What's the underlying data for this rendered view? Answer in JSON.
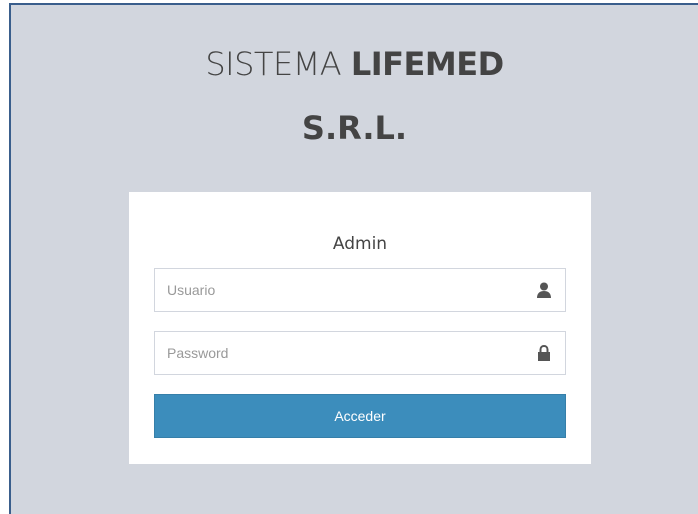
{
  "logo": {
    "prefix": "SISTEMA ",
    "brand": "LIFEMED",
    "suffix": "S.R.L."
  },
  "login": {
    "title": "Admin",
    "username": {
      "placeholder": "Usuario",
      "value": "",
      "icon": "user-icon"
    },
    "password": {
      "placeholder": "Password",
      "value": "",
      "icon": "lock-icon"
    },
    "submit_label": "Acceder"
  },
  "colors": {
    "background": "#d2d6de",
    "primary": "#3c8dbc",
    "text": "#444444"
  }
}
